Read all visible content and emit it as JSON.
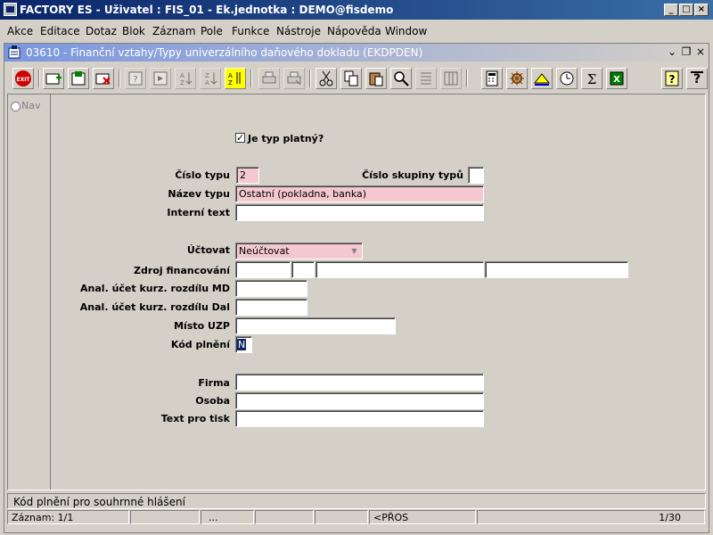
{
  "window": {
    "title": "FACTORY ES - Uživatel : FIS_01 - Ek.jednotka : DEMO@fisdemo"
  },
  "menu": [
    "Akce",
    "Editace",
    "Dotaz",
    "Blok",
    "Záznam",
    "Pole",
    "Funkce",
    "Nástroje",
    "Nápověda",
    "Window"
  ],
  "form": {
    "title": "03610 - Finanční vztahy/Typy univerzálního daňového dokladu (EKDPDEN)",
    "nav_label": "Nav",
    "je_typ_platny": {
      "label": "Je typ platný?",
      "checked": true
    },
    "cislo_typu": {
      "label": "Číslo typu",
      "value": "2"
    },
    "cislo_skupiny": {
      "label": "Číslo skupiny typů",
      "value": ""
    },
    "nazev_typu": {
      "label": "Název typu",
      "value": "Ostatní (pokladna, banka)"
    },
    "interni_text": {
      "label": "Interní text",
      "value": ""
    },
    "uctovat": {
      "label": "Účtovat",
      "value": "Neúčtovat"
    },
    "zdroj": {
      "label": "Zdroj financování",
      "values": [
        "",
        "",
        "",
        ""
      ]
    },
    "anal_md": {
      "label": "Anal. účet kurz. rozdílu MD",
      "value": ""
    },
    "anal_dal": {
      "label": "Anal. účet kurz. rozdílu Dal",
      "value": ""
    },
    "misto_uzp": {
      "label": "Místo UZP",
      "value": ""
    },
    "kod_plneni": {
      "label": "Kód plnění",
      "value": "N"
    },
    "firma": {
      "label": "Firma",
      "value": ""
    },
    "osoba": {
      "label": "Osoba",
      "value": ""
    },
    "text_pro_tisk": {
      "label": "Text pro tisk",
      "value": ""
    }
  },
  "status": {
    "message": "Kód plnění pro souhrnné hlášení",
    "record": "Záznam: 1/1",
    "ellipsis": "...",
    "mode": "<PŘOS",
    "page": "1/30"
  },
  "toolbar_icons": [
    "exit-icon",
    "insert-record-icon",
    "save-icon",
    "delete-record-icon",
    "enter-query-icon",
    "execute-query-icon",
    "sort-asc-icon",
    "sort-desc-icon",
    "sort-icon",
    "print-icon",
    "print-setup-icon",
    "cut-icon",
    "copy-icon",
    "paste-icon",
    "search-icon",
    "list-icon",
    "columns-icon",
    "calculator-icon",
    "helm-icon",
    "scale-icon",
    "clock-icon",
    "sum-icon",
    "excel-icon",
    "help-icon",
    "whats-this-icon"
  ],
  "colors": {
    "title_bar": "#0a246a",
    "required_field": "#f4c8cf",
    "background": "#d4d0c8"
  }
}
